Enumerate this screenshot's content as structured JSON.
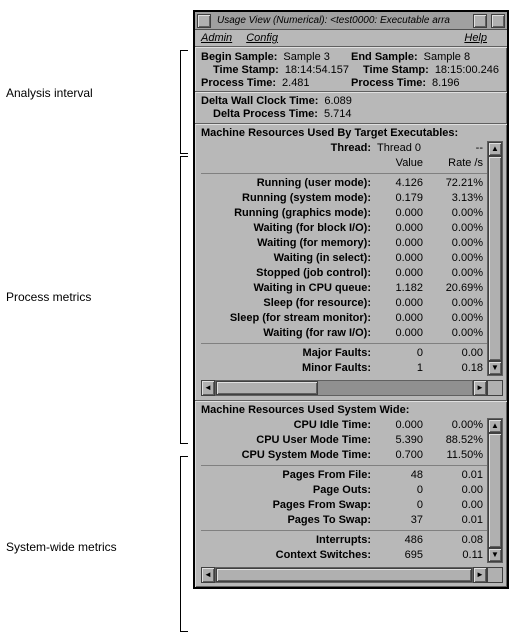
{
  "window_title": "Usage View (Numerical): <test0000: Executable arra",
  "menubar": {
    "admin": "Admin",
    "config": "Config",
    "help": "Help"
  },
  "callouts": {
    "analysis": "Analysis interval",
    "process": "Process metrics",
    "system": "System-wide metrics"
  },
  "interval": {
    "begin": {
      "sample_label": "Begin Sample:",
      "sample": "Sample 3",
      "ts_label": "Time Stamp:",
      "ts": "18:14:54.157",
      "pt_label": "Process Time:",
      "pt": "2.481"
    },
    "end": {
      "sample_label": "End Sample:",
      "sample": "Sample 8",
      "ts_label": "Time Stamp:",
      "ts": "18:15:00.246",
      "pt_label": "Process Time:",
      "pt": "8.196"
    }
  },
  "delta": {
    "wall_label": "Delta Wall Clock Time:",
    "wall": "6.089",
    "proc_label": "Delta Process Time:",
    "proc": "5.714"
  },
  "process_panel": {
    "title": "Machine Resources Used By Target Executables:",
    "thread_label": "Thread:",
    "thread_value": "Thread 0",
    "thread_extra": "--",
    "col1": "Value",
    "col2": "Rate /s",
    "rows": [
      {
        "label": "Running (user mode):",
        "v": "4.126",
        "r": "72.21%"
      },
      {
        "label": "Running (system mode):",
        "v": "0.179",
        "r": "3.13%"
      },
      {
        "label": "Running (graphics mode):",
        "v": "0.000",
        "r": "0.00%"
      },
      {
        "label": "Waiting (for block I/O):",
        "v": "0.000",
        "r": "0.00%"
      },
      {
        "label": "Waiting (for memory):",
        "v": "0.000",
        "r": "0.00%"
      },
      {
        "label": "Waiting (in select):",
        "v": "0.000",
        "r": "0.00%"
      },
      {
        "label": "Stopped (job control):",
        "v": "0.000",
        "r": "0.00%"
      },
      {
        "label": "Waiting in CPU queue:",
        "v": "1.182",
        "r": "20.69%"
      },
      {
        "label": "Sleep (for resource):",
        "v": "0.000",
        "r": "0.00%"
      },
      {
        "label": "Sleep (for stream monitor):",
        "v": "0.000",
        "r": "0.00%"
      },
      {
        "label": "Waiting (for raw I/O):",
        "v": "0.000",
        "r": "0.00%"
      }
    ],
    "faults": [
      {
        "label": "Major Faults:",
        "v": "0",
        "r": "0.00"
      },
      {
        "label": "Minor Faults:",
        "v": "1",
        "r": "0.18"
      }
    ]
  },
  "system_panel": {
    "title": "Machine Resources Used System Wide:",
    "cpu": [
      {
        "label": "CPU Idle Time:",
        "v": "0.000",
        "r": "0.00%"
      },
      {
        "label": "CPU User Mode Time:",
        "v": "5.390",
        "r": "88.52%"
      },
      {
        "label": "CPU System Mode Time:",
        "v": "0.700",
        "r": "11.50%"
      }
    ],
    "pages": [
      {
        "label": "Pages From File:",
        "v": "48",
        "r": "0.01"
      },
      {
        "label": "Page Outs:",
        "v": "0",
        "r": "0.00"
      },
      {
        "label": "Pages From Swap:",
        "v": "0",
        "r": "0.00"
      },
      {
        "label": "Pages To Swap:",
        "v": "37",
        "r": "0.01"
      }
    ],
    "intr": [
      {
        "label": "Interrupts:",
        "v": "486",
        "r": "0.08"
      },
      {
        "label": "Context Switches:",
        "v": "695",
        "r": "0.11"
      }
    ]
  }
}
